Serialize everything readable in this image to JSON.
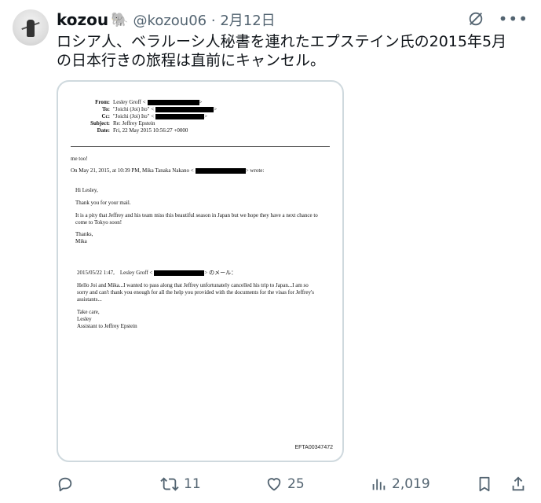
{
  "author": {
    "name": "kozou",
    "badge_icon": "elephant-icon",
    "handle": "@kozou06",
    "separator": "·",
    "date": "2月12日"
  },
  "tweet": {
    "line1": "ロシア人、ベラルーシ人秘書を連れたエプステイン氏の2015年5月",
    "line2": "の日本行きの旅程は直前にキャンセル。"
  },
  "document": {
    "from_label": "From:",
    "from_value": "Lesley Groff <",
    "to_label": "To:",
    "to_value": "\"Joichi (Joi) Ito\" <",
    "cc_label": "Cc:",
    "cc_value": "\"Joichi (Joi) Ito\" <",
    "subject_label": "Subject:",
    "subject_value": "Re: Jeffrey Epstein",
    "date_label": "Date:",
    "date_value": "Fri, 22 May 2015 10:56:27 +0000",
    "me_too": "me too!",
    "on_date_prefix": "On May 21, 2015, at 10:39 PM, Mika Tanaka Nakano <",
    "on_date_suffix": "> wrote:",
    "greeting": "Hi Lesley,",
    "thanks_mail": "Thank you for your mail.",
    "pity_line1": "It is a pity that Jeffrey and his team miss this beautiful season in Japan but we hope they have a next chance to",
    "pity_line2": "come to Tokyo soon!",
    "thanks": "Thanks,",
    "sign_mika": "Mika",
    "quote_header_prefix": "2015/05/22 1:47,　Lesley Groff <",
    "quote_header_suffix": "> のメール：",
    "quote_line1": "Hello Joi and Mika...I wanted to pass along that Jeffrey unfortunately cancelled his trip to Japan...I am so",
    "quote_line2": "sorry and can't thank you enough for all the help you provided with the documents for the visas for Jeffrey's",
    "quote_line3": "assistants...",
    "take_care": "Take care,",
    "sign_lesley": "Lesley",
    "assistant": "Assistant to Jeffrey Epstein",
    "doc_id": "EFTA00347472"
  },
  "actions": {
    "reply_icon": "reply-icon",
    "retweet_icon": "retweet-icon",
    "retweet_count": "11",
    "like_icon": "heart-icon",
    "like_count": "25",
    "views_icon": "views-icon",
    "views_count": "2,019",
    "bookmark_icon": "bookmark-icon",
    "share_icon": "share-icon"
  },
  "colors": {
    "text": "#0f1419",
    "muted": "#536471",
    "border": "#cfd9de"
  }
}
